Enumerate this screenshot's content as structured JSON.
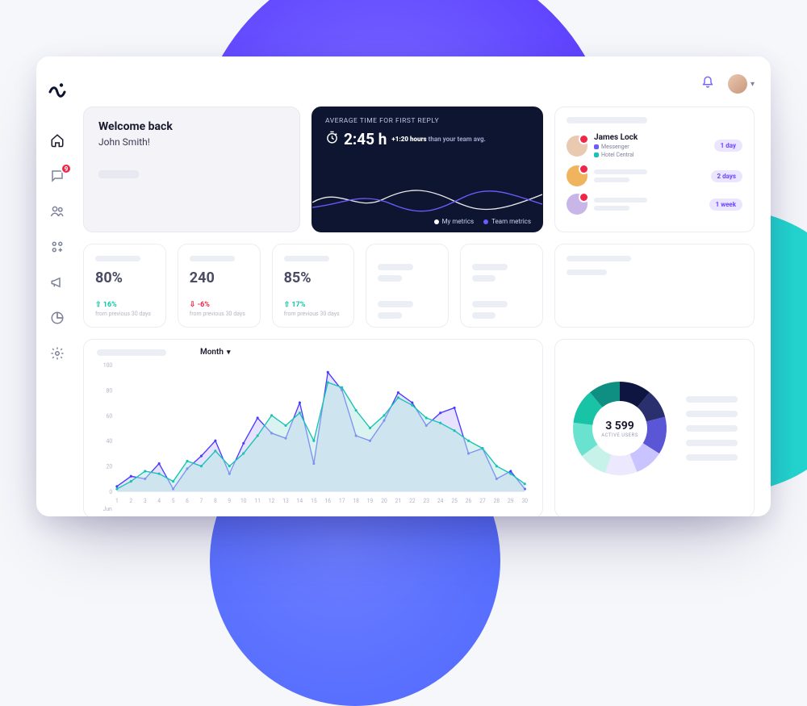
{
  "sidebar": {
    "inbox_badge": "9"
  },
  "welcome": {
    "title": "Welcome back",
    "name": "John Smith!"
  },
  "reply_card": {
    "label": "AVERAGE TIME FOR FIRST REPLY",
    "value": "2:45 h",
    "diff_value": "+1:20 hours",
    "diff_tail": "than your team avg.",
    "legend_my": "My metrics",
    "legend_team": "Team metrics"
  },
  "leads": [
    {
      "name": "James Lock",
      "channel": "Messenger",
      "place": "Hotel Central",
      "badge": "1 day",
      "avatar": "#e9c9b0"
    },
    {
      "badge": "2 days",
      "avatar": "#f0b45e"
    },
    {
      "badge": "1 week",
      "avatar": "#c9b6e8"
    }
  ],
  "stats": [
    {
      "value": "80%",
      "delta": "16%",
      "dir": "up",
      "from": "from previous 30 days"
    },
    {
      "value": "240",
      "delta": "-6%",
      "dir": "dn",
      "from": "from previous 30 days"
    },
    {
      "value": "85%",
      "delta": "17%",
      "dir": "up",
      "from": "from previous 30 days"
    }
  ],
  "chart_controls": {
    "period": "Month",
    "xaxis_footer": "Jun"
  },
  "chart_data": {
    "type": "line",
    "title": "",
    "xlabel": "Jun",
    "ylabel": "",
    "x": [
      1,
      2,
      3,
      4,
      5,
      6,
      7,
      8,
      9,
      10,
      11,
      12,
      13,
      14,
      15,
      16,
      17,
      18,
      19,
      20,
      21,
      22,
      23,
      24,
      25,
      26,
      27,
      28,
      29,
      30
    ],
    "ylim": [
      0,
      100
    ],
    "yticks": [
      0,
      20,
      40,
      60,
      80,
      100
    ],
    "series": [
      {
        "name": "My metrics",
        "color": "#4a3cff",
        "fill": "#cfc8ff",
        "values": [
          4,
          12,
          10,
          22,
          2,
          18,
          28,
          40,
          14,
          38,
          58,
          46,
          42,
          70,
          22,
          94,
          80,
          44,
          40,
          56,
          78,
          70,
          52,
          62,
          66,
          30,
          34,
          10,
          16,
          2
        ]
      },
      {
        "name": "Team metrics",
        "color": "#18c3b4",
        "fill": "#b6e7e1",
        "values": [
          2,
          8,
          16,
          14,
          8,
          24,
          20,
          32,
          20,
          30,
          44,
          60,
          52,
          62,
          40,
          86,
          82,
          64,
          50,
          60,
          74,
          68,
          58,
          54,
          48,
          40,
          34,
          20,
          14,
          6
        ]
      }
    ]
  },
  "donut": {
    "center_value": "3 599",
    "center_label": "ACTIVE USERS",
    "slices": [
      {
        "color": "#0e1540",
        "v": 11
      },
      {
        "color": "#2a2f6d",
        "v": 10
      },
      {
        "color": "#5a56d6",
        "v": 13
      },
      {
        "color": "#c9c3ff",
        "v": 10
      },
      {
        "color": "#ece9ff",
        "v": 11
      },
      {
        "color": "#c7f2ea",
        "v": 10
      },
      {
        "color": "#69e3cf",
        "v": 12
      },
      {
        "color": "#18c3a6",
        "v": 12
      },
      {
        "color": "#0e8f82",
        "v": 11
      }
    ]
  }
}
